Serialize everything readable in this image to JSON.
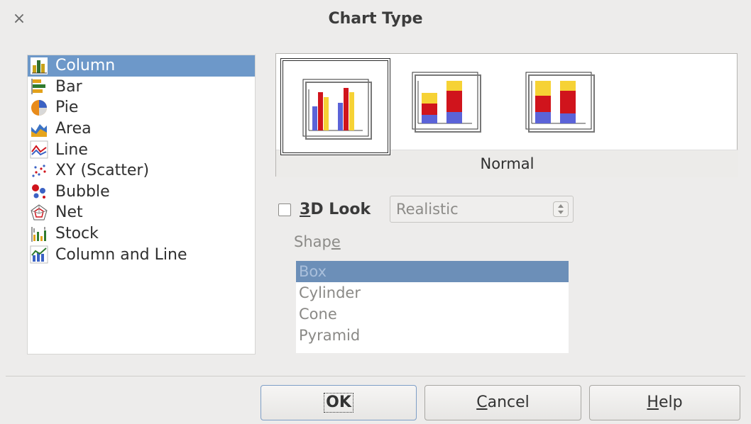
{
  "window": {
    "title": "Chart Type",
    "close_glyph": "×"
  },
  "chart_types": [
    {
      "label": "Column",
      "icon": "column-chart-icon",
      "selected": true
    },
    {
      "label": "Bar",
      "icon": "bar-chart-icon",
      "selected": false
    },
    {
      "label": "Pie",
      "icon": "pie-chart-icon",
      "selected": false
    },
    {
      "label": "Area",
      "icon": "area-chart-icon",
      "selected": false
    },
    {
      "label": "Line",
      "icon": "line-chart-icon",
      "selected": false
    },
    {
      "label": "XY (Scatter)",
      "icon": "scatter-chart-icon",
      "selected": false
    },
    {
      "label": "Bubble",
      "icon": "bubble-chart-icon",
      "selected": false
    },
    {
      "label": "Net",
      "icon": "net-chart-icon",
      "selected": false
    },
    {
      "label": "Stock",
      "icon": "stock-chart-icon",
      "selected": false
    },
    {
      "label": "Column and Line",
      "icon": "column-line-chart-icon",
      "selected": false
    }
  ],
  "variants": {
    "caption": "Normal",
    "items": [
      "normal",
      "stacked",
      "percent-stacked"
    ],
    "selected": "normal"
  },
  "look3d": {
    "label": "3D Look",
    "mnemonic": "3",
    "rest": "D Look",
    "checked": false,
    "select_value": "Realistic"
  },
  "shape": {
    "label_prefix": "Shap",
    "label_mnemonic": "e",
    "items": [
      "Box",
      "Cylinder",
      "Cone",
      "Pyramid"
    ],
    "selected": "Box"
  },
  "buttons": {
    "ok_label": "OK",
    "cancel_mnemonic": "C",
    "cancel_rest": "ancel",
    "help_mnemonic": "H",
    "help_rest": "elp"
  },
  "colors": {
    "selection_blue": "#6d98c9",
    "bar_blue": "#5b63d8",
    "bar_red": "#d0141c",
    "bar_yellow": "#f6d235"
  }
}
